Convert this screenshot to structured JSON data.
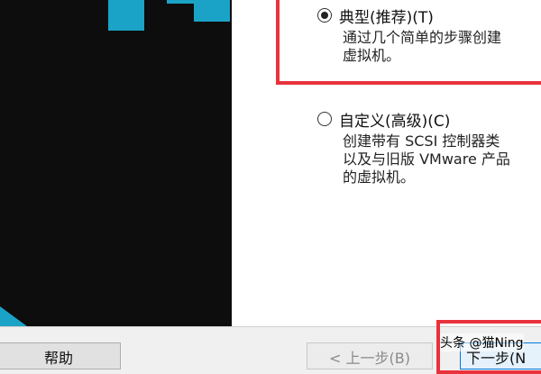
{
  "wizard": {
    "options": [
      {
        "label": "典型(推荐)(T)",
        "selected": true,
        "description_lines": [
          "通过几个简单的步骤创建",
          "虚拟机。"
        ]
      },
      {
        "label": "自定义(高级)(C)",
        "selected": false,
        "description_lines": [
          "创建带有 SCSI 控制器类",
          "以及与旧版 VMware 产品",
          "的虚拟机。"
        ]
      }
    ],
    "buttons": {
      "help": "帮助",
      "back": "< 上一步(B)",
      "next": "下一步(N"
    }
  },
  "watermark": "头条 @猫Ning",
  "colors": {
    "highlight": "#e8323c",
    "panel_bg": "#0d0d0d",
    "logo_accent": "#1aa3c6"
  }
}
